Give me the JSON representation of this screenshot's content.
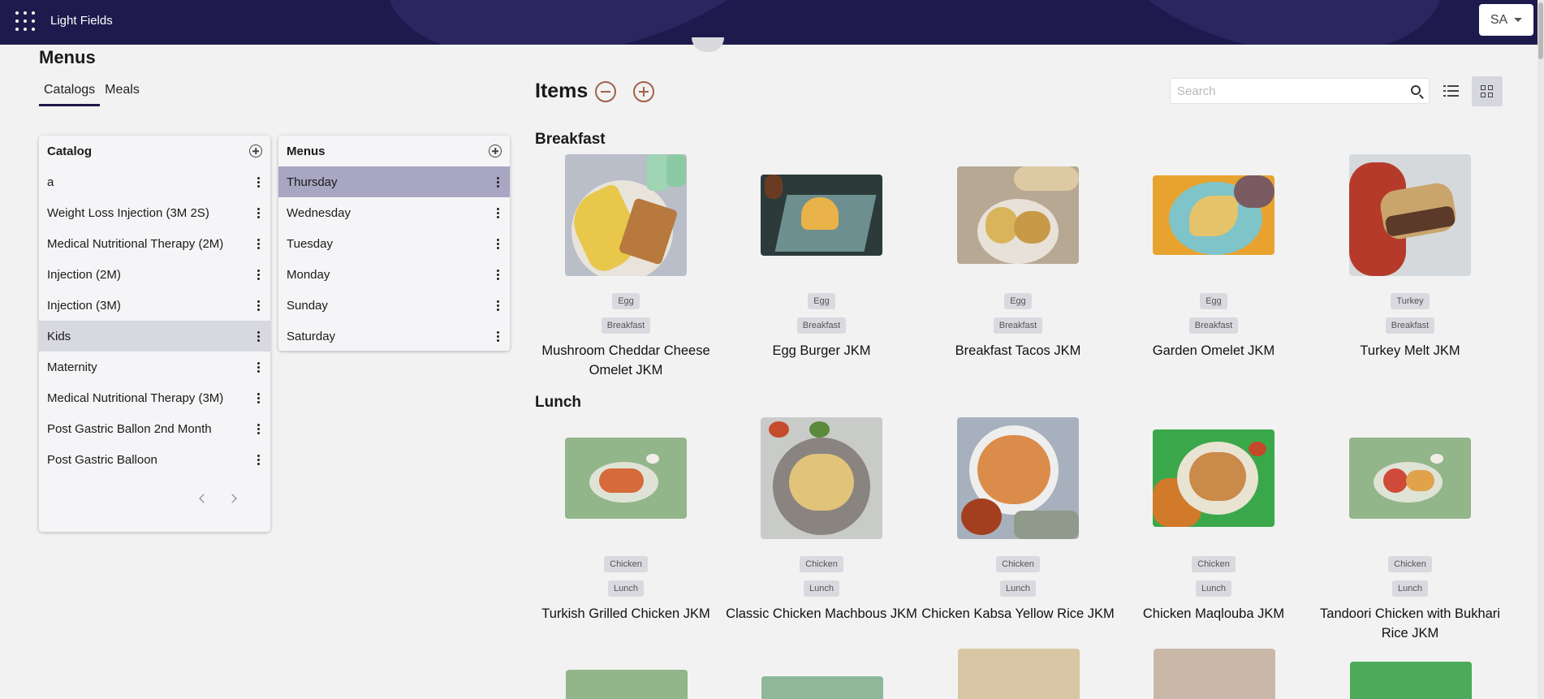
{
  "app": {
    "title": "Light Fields",
    "user_initials": "SA"
  },
  "page": {
    "title": "Menus",
    "tabs": [
      "Catalogs",
      "Meals"
    ],
    "active_tab": "Catalogs"
  },
  "catalog_panel": {
    "header": "Catalog",
    "items": [
      "a",
      "Weight Loss Injection (3M 2S)",
      "Medical Nutritional Therapy (2M)",
      "Injection (2M)",
      "Injection (3M)",
      "Kids",
      "Maternity",
      "Medical Nutritional Therapy (3M)",
      "Post Gastric Ballon 2nd Month",
      "Post Gastric Balloon"
    ],
    "selected": "Kids"
  },
  "menus_panel": {
    "header": "Menus",
    "items": [
      "Thursday",
      "Wednesday",
      "Tuesday",
      "Monday",
      "Sunday",
      "Saturday"
    ],
    "selected": "Thursday"
  },
  "items": {
    "title": "Items",
    "search_placeholder": "Search",
    "sections": [
      {
        "title": "Breakfast",
        "cards": [
          {
            "name": "Mushroom Cheddar Cheese Omelet JKM",
            "tags": [
              "Egg",
              "Breakfast"
            ]
          },
          {
            "name": "Egg Burger JKM",
            "tags": [
              "Egg",
              "Breakfast"
            ]
          },
          {
            "name": "Breakfast Tacos JKM",
            "tags": [
              "Egg",
              "Breakfast"
            ]
          },
          {
            "name": "Garden Omelet JKM",
            "tags": [
              "Egg",
              "Breakfast"
            ]
          },
          {
            "name": "Turkey Melt JKM",
            "tags": [
              "Turkey",
              "Breakfast"
            ]
          }
        ]
      },
      {
        "title": "Lunch",
        "cards": [
          {
            "name": "Turkish Grilled Chicken JKM",
            "tags": [
              "Chicken",
              "Lunch"
            ]
          },
          {
            "name": "Classic Chicken Machbous JKM",
            "tags": [
              "Chicken",
              "Lunch"
            ]
          },
          {
            "name": "Chicken Kabsa Yellow Rice JKM",
            "tags": [
              "Chicken",
              "Lunch"
            ]
          },
          {
            "name": "Chicken Maqlouba JKM",
            "tags": [
              "Chicken",
              "Lunch"
            ]
          },
          {
            "name": "Tandoori Chicken with Bukhari Rice JKM",
            "tags": [
              "Chicken",
              "Lunch"
            ]
          }
        ]
      }
    ]
  }
}
